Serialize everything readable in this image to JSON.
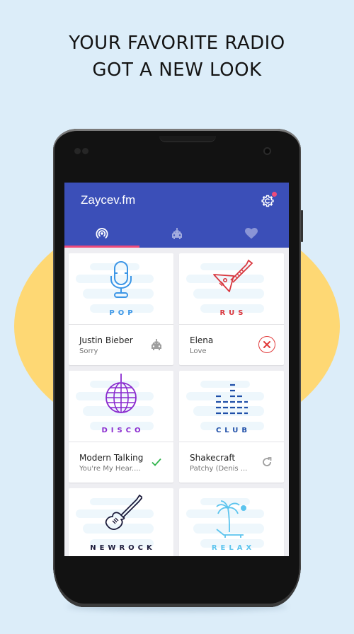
{
  "promo": {
    "headline_line1": "YOUR FAVORITE RADIO",
    "headline_line2": "GOT A NEW LOOK"
  },
  "app": {
    "title": "Zaycev.fm",
    "settings_icon": "gear-icon",
    "has_notification": true,
    "colors": {
      "appbar": "#3b4fb8",
      "tab_indicator": "#ed4b7c",
      "notification_dot": "#ee4b7b"
    }
  },
  "tabs": [
    {
      "name": "radio",
      "icon": "radio-broadcast-icon",
      "active": true
    },
    {
      "name": "downloads",
      "icon": "car-download-icon",
      "active": false
    },
    {
      "name": "favorites",
      "icon": "heart-icon",
      "active": false
    }
  ],
  "stations": [
    {
      "genre": "POP",
      "color": "#3c96e6",
      "icon": "microphone-icon",
      "artist": "Justin Bieber",
      "song": "Sorry",
      "status": "download",
      "status_icon": "car-download-icon"
    },
    {
      "genre": "RUS",
      "color": "#d9383f",
      "icon": "balalaika-icon",
      "artist": "Elena",
      "song": "Love",
      "status": "downloading",
      "status_icon": "cancel-icon"
    },
    {
      "genre": "DISCO",
      "color": "#8a2bcf",
      "icon": "disco-ball-icon",
      "artist": "Modern Talking",
      "song": "You're My Hear....",
      "status": "downloaded",
      "status_icon": "check-icon"
    },
    {
      "genre": "CLUB",
      "color": "#1f4fa8",
      "icon": "equalizer-icon",
      "artist": "Shakecraft",
      "song": "Patchy (Denis ...",
      "status": "retry",
      "status_icon": "refresh-icon"
    },
    {
      "genre": "NEWROCK",
      "color": "#1a1a3a",
      "icon": "electric-guitar-icon"
    },
    {
      "genre": "RELAX",
      "color": "#5bc4ee",
      "icon": "palm-tree-icon"
    }
  ]
}
